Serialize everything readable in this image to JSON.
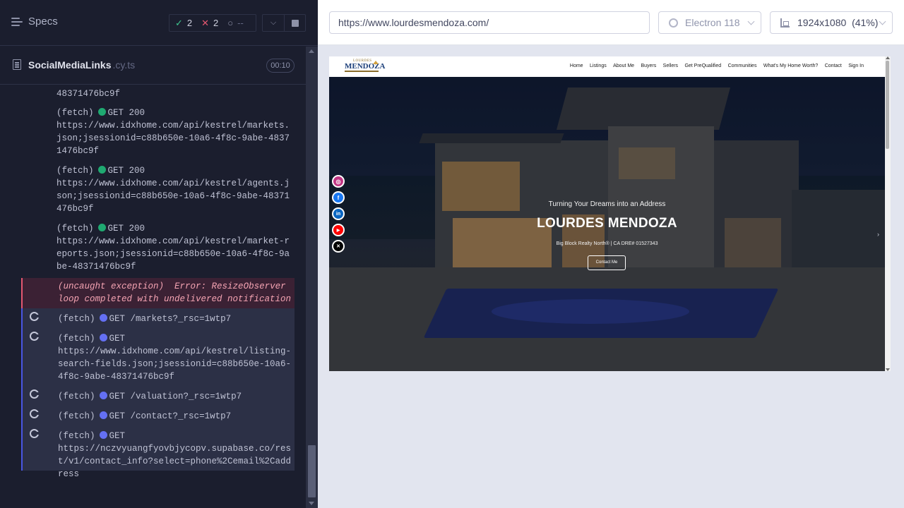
{
  "left": {
    "specs_label": "Specs",
    "stats": {
      "passed": "2",
      "failed": "2",
      "pending": "--"
    },
    "spec": {
      "name": "SocialMediaLinks",
      "ext": ".cy.ts",
      "duration": "00:10"
    },
    "log": [
      {
        "label": "",
        "text": "48371476bc9f",
        "status": "",
        "kind": "plain"
      },
      {
        "label": "(fetch)",
        "method": "GET 200",
        "text": "https://www.idxhome.com/api/kestrel/markets.json;jsessionid=c88b650e-10a6-4f8c-9abe-48371476bc9f",
        "kind": "done"
      },
      {
        "label": "(fetch)",
        "method": "GET 200",
        "text": "https://www.idxhome.com/api/kestrel/agents.json;jsessionid=c88b650e-10a6-4f8c-9abe-48371476bc9f",
        "kind": "done"
      },
      {
        "label": "(fetch)",
        "method": "GET 200",
        "text": "https://www.idxhome.com/api/kestrel/market-reports.json;jsessionid=c88b650e-10a6-4f8c-9abe-48371476bc9f",
        "kind": "done"
      },
      {
        "label": "(uncaught exception)",
        "text": "Error: ResizeObserver loop completed with undelivered notifications.",
        "kind": "error"
      },
      {
        "label": "(fetch)",
        "method": "GET",
        "text": "/markets?_rsc=1wtp7",
        "kind": "pending"
      },
      {
        "label": "(fetch)",
        "method": "GET",
        "text": "https://www.idxhome.com/api/kestrel/listing-search-fields.json;jsessionid=c88b650e-10a6-4f8c-9abe-48371476bc9f",
        "kind": "pending"
      },
      {
        "label": "(fetch)",
        "method": "GET",
        "text": "/valuation?_rsc=1wtp7",
        "kind": "pending"
      },
      {
        "label": "(fetch)",
        "method": "GET",
        "text": "/contact?_rsc=1wtp7",
        "kind": "pending"
      },
      {
        "label": "(fetch)",
        "method": "GET",
        "text": "https://nczvyuangfyovbjycopv.supabase.co/rest/v1/contact_info?select=phone%2Cemail%2Caddress",
        "kind": "pending"
      }
    ]
  },
  "right": {
    "url": "https://www.lourdesmendoza.com/",
    "browser": "Electron 118",
    "viewport": "1924x1080  (41%)"
  },
  "site": {
    "logo_top": "LOURDES",
    "logo_main": "MENDOZA",
    "nav": [
      "Home",
      "Listings",
      "About Me",
      "Buyers",
      "Sellers",
      "Get PreQualified",
      "Communities",
      "What's My Home Worth?",
      "Contact",
      "Sign In"
    ],
    "tagline": "Turning Your Dreams into an Address",
    "title": "LOURDES MENDOZA",
    "subtitle": "Big Block Realty North® | CA DRE# 01527343",
    "cta": "Contact Me",
    "social_icons": [
      "instagram-icon",
      "facebook-icon",
      "linkedin-icon",
      "youtube-icon",
      "x-icon"
    ],
    "colors": {
      "instagram": "#c13584",
      "facebook": "#1877f2",
      "linkedin": "#0a66c2",
      "youtube": "#ff0000",
      "x": "#000000"
    }
  }
}
